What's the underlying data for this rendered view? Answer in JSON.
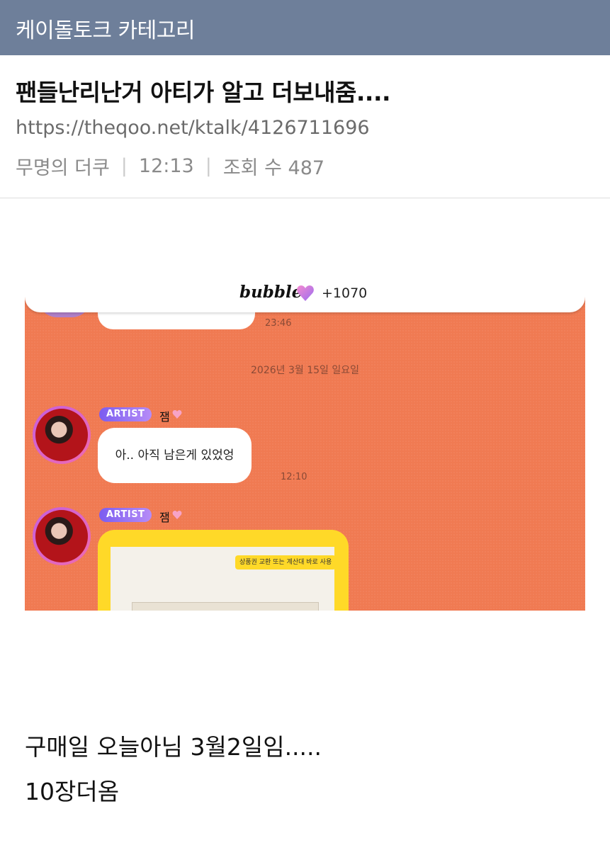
{
  "header": {
    "category": "케이돌토크 카테고리"
  },
  "post": {
    "title": "팬들난리난거 아티가 알고 더보내줌....",
    "url": "https://theqoo.net/ktalk/4126711696",
    "author": "무명의 더쿠",
    "time": "12:13",
    "views": "조회 수 487"
  },
  "screenshot": {
    "app_logo": "bubble",
    "heart_icon": "heart-icon",
    "count": "+1070",
    "prev_time": "23:46",
    "date_divider": "2026년 3월 15일 일요일",
    "messages": [
      {
        "badge": "ARTIST",
        "name": "잼",
        "text": "아.. 아직 남은게 있었엉",
        "time": "12:10"
      },
      {
        "badge": "ARTIST",
        "name": "잼",
        "coupon_label": "상품권 교환 또는 계산대 바로 사용"
      }
    ],
    "colors": {
      "background": "#f07a52",
      "badge": "#7b5cf0",
      "coupon": "#ffd928"
    }
  },
  "caption": {
    "line1": "구매일 오늘아님 3월2일임.....",
    "line2": "10장더옴"
  }
}
